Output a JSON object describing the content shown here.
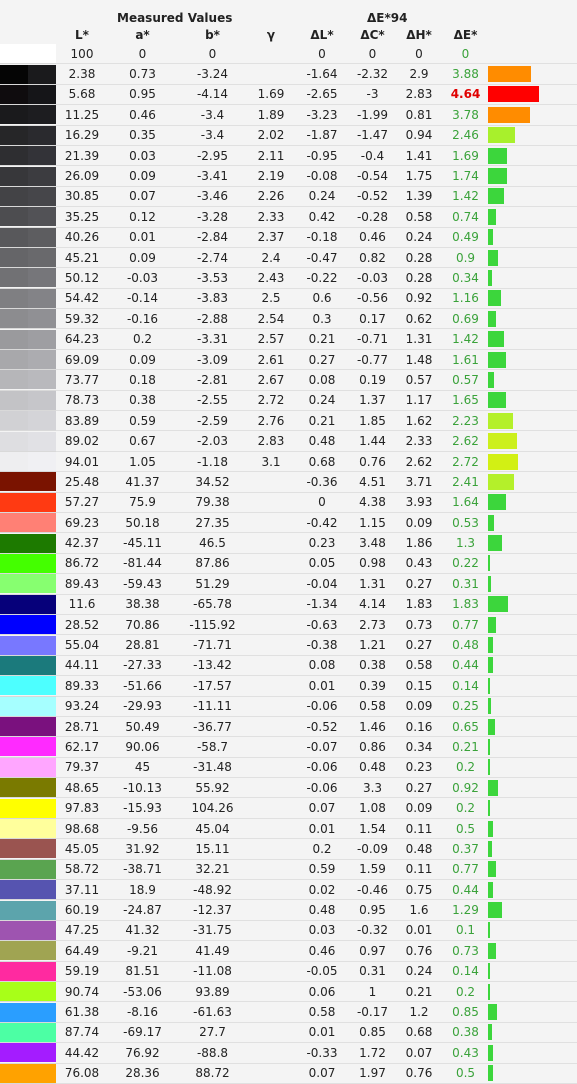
{
  "header": {
    "measured_title": "Measured Values",
    "delta_title": "ΔE*94",
    "columns": [
      "L*",
      "a*",
      "b*",
      "γ",
      "ΔL*",
      "ΔC*",
      "ΔH*",
      "ΔE*"
    ]
  },
  "rows": [
    {
      "sw": [
        "#ffffff",
        "#ffffff"
      ],
      "L": "100",
      "a": "0",
      "b": "0",
      "g": "",
      "dL": "0",
      "dC": "0",
      "dH": "0",
      "dE": "0",
      "bar": 0,
      "barColor": "#3cd63c"
    },
    {
      "sw": [
        "#050505",
        "#1a1a1c"
      ],
      "L": "2.38",
      "a": "0.73",
      "b": "-3.24",
      "g": "",
      "dL": "-1.64",
      "dC": "-2.32",
      "dH": "2.9",
      "dE": "3.88",
      "bar": 3.88,
      "barColor": "#ff8c00"
    },
    {
      "sw": [
        "#0f0c0e",
        "#151518"
      ],
      "L": "5.68",
      "a": "0.95",
      "b": "-4.14",
      "g": "1.69",
      "dL": "-2.65",
      "dC": "-3",
      "dH": "2.83",
      "dE": "4.64",
      "bar": 4.64,
      "barColor": "#ff0000",
      "warn": true
    },
    {
      "sw": [
        "#1a1a1c",
        "#1d1d20"
      ],
      "L": "11.25",
      "a": "0.46",
      "b": "-3.4",
      "g": "1.89",
      "dL": "-3.23",
      "dC": "-1.99",
      "dH": "0.81",
      "dE": "3.78",
      "bar": 3.78,
      "barColor": "#ff8c00"
    },
    {
      "sw": [
        "#262628",
        "#2a2a2e"
      ],
      "L": "16.29",
      "a": "0.35",
      "b": "-3.4",
      "g": "2.02",
      "dL": "-1.87",
      "dC": "-1.47",
      "dH": "0.94",
      "dE": "2.46",
      "bar": 2.46,
      "barColor": "#a8f02c"
    },
    {
      "sw": [
        "#2e2e31",
        "#333338"
      ],
      "L": "21.39",
      "a": "0.03",
      "b": "-2.95",
      "g": "2.11",
      "dL": "-0.95",
      "dC": "-0.4",
      "dH": "1.41",
      "dE": "1.69",
      "bar": 1.69,
      "barColor": "#3cd63c"
    },
    {
      "sw": [
        "#37373a",
        "#3c3c40"
      ],
      "L": "26.09",
      "a": "0.09",
      "b": "-3.41",
      "g": "2.19",
      "dL": "-0.08",
      "dC": "-0.54",
      "dH": "1.75",
      "dE": "1.74",
      "bar": 1.74,
      "barColor": "#3cd63c"
    },
    {
      "sw": [
        "#434346",
        "#46464a"
      ],
      "L": "30.85",
      "a": "0.07",
      "b": "-3.46",
      "g": "2.26",
      "dL": "0.24",
      "dC": "-0.52",
      "dH": "1.39",
      "dE": "1.42",
      "bar": 1.42,
      "barColor": "#3cd63c"
    },
    {
      "sw": [
        "#4d4d50",
        "#525256"
      ],
      "L": "35.25",
      "a": "0.12",
      "b": "-3.28",
      "g": "2.33",
      "dL": "0.42",
      "dC": "-0.28",
      "dH": "0.58",
      "dE": "0.74",
      "bar": 0.74,
      "barColor": "#3cd63c"
    },
    {
      "sw": [
        "#58585b",
        "#5d5d60"
      ],
      "L": "40.26",
      "a": "0.01",
      "b": "-2.84",
      "g": "2.37",
      "dL": "-0.18",
      "dC": "0.46",
      "dH": "0.24",
      "dE": "0.49",
      "bar": 0.49,
      "barColor": "#3cd63c"
    },
    {
      "sw": [
        "#656568",
        "#69696c"
      ],
      "L": "45.21",
      "a": "0.09",
      "b": "-2.74",
      "g": "2.4",
      "dL": "-0.47",
      "dC": "0.82",
      "dH": "0.28",
      "dE": "0.9",
      "bar": 0.9,
      "barColor": "#3cd63c"
    },
    {
      "sw": [
        "#717174",
        "#76767a"
      ],
      "L": "50.12",
      "a": "-0.03",
      "b": "-3.53",
      "g": "2.43",
      "dL": "-0.22",
      "dC": "-0.03",
      "dH": "0.28",
      "dE": "0.34",
      "bar": 0.34,
      "barColor": "#3cd63c"
    },
    {
      "sw": [
        "#7f7f82",
        "#838387"
      ],
      "L": "54.42",
      "a": "-0.14",
      "b": "-3.83",
      "g": "2.5",
      "dL": "0.6",
      "dC": "-0.56",
      "dH": "0.92",
      "dE": "1.16",
      "bar": 1.16,
      "barColor": "#3cd63c"
    },
    {
      "sw": [
        "#8c8c8f",
        "#909094"
      ],
      "L": "59.32",
      "a": "-0.16",
      "b": "-2.88",
      "g": "2.54",
      "dL": "0.3",
      "dC": "0.17",
      "dH": "0.62",
      "dE": "0.69",
      "bar": 0.69,
      "barColor": "#3cd63c"
    },
    {
      "sw": [
        "#9a9a9d",
        "#9e9ea2"
      ],
      "L": "64.23",
      "a": "0.2",
      "b": "-3.31",
      "g": "2.57",
      "dL": "0.21",
      "dC": "-0.71",
      "dH": "1.31",
      "dE": "1.42",
      "bar": 1.42,
      "barColor": "#3cd63c"
    },
    {
      "sw": [
        "#a8a8ab",
        "#acacb0"
      ],
      "L": "69.09",
      "a": "0.09",
      "b": "-3.09",
      "g": "2.61",
      "dL": "0.27",
      "dC": "-0.77",
      "dH": "1.48",
      "dE": "1.61",
      "bar": 1.61,
      "barColor": "#3cd63c"
    },
    {
      "sw": [
        "#b6b6b9",
        "#b9b9bd"
      ],
      "L": "73.77",
      "a": "0.18",
      "b": "-2.81",
      "g": "2.67",
      "dL": "0.08",
      "dC": "0.19",
      "dH": "0.57",
      "dE": "0.57",
      "bar": 0.57,
      "barColor": "#3cd63c"
    },
    {
      "sw": [
        "#c3c3c6",
        "#c6c6ca"
      ],
      "L": "78.73",
      "a": "0.38",
      "b": "-2.55",
      "g": "2.72",
      "dL": "0.24",
      "dC": "1.37",
      "dH": "1.17",
      "dE": "1.65",
      "bar": 1.65,
      "barColor": "#3cd63c"
    },
    {
      "sw": [
        "#d1d1d4",
        "#d4d4d8"
      ],
      "L": "83.89",
      "a": "0.59",
      "b": "-2.59",
      "g": "2.76",
      "dL": "0.21",
      "dC": "1.85",
      "dH": "1.62",
      "dE": "2.23",
      "bar": 2.23,
      "barColor": "#b4f02a"
    },
    {
      "sw": [
        "#dedee1",
        "#e1e1e5"
      ],
      "L": "89.02",
      "a": "0.67",
      "b": "-2.03",
      "g": "2.83",
      "dL": "0.48",
      "dC": "1.44",
      "dH": "2.33",
      "dE": "2.62",
      "bar": 2.62,
      "barColor": "#ccf01c"
    },
    {
      "sw": [
        "#eeeef0",
        "#f0f0f3"
      ],
      "L": "94.01",
      "a": "1.05",
      "b": "-1.18",
      "g": "3.1",
      "dL": "0.68",
      "dC": "0.76",
      "dH": "2.62",
      "dE": "2.72",
      "bar": 2.72,
      "barColor": "#d2f014"
    },
    {
      "sw": [
        "#7a1300",
        "#7a1300"
      ],
      "L": "25.48",
      "a": "41.37",
      "b": "34.52",
      "g": "",
      "dL": "-0.36",
      "dC": "4.51",
      "dH": "3.71",
      "dE": "2.41",
      "bar": 2.41,
      "barColor": "#b4f02a"
    },
    {
      "sw": [
        "#ff3a12",
        "#ff3a12"
      ],
      "L": "57.27",
      "a": "75.9",
      "b": "79.38",
      "g": "",
      "dL": "0",
      "dC": "4.38",
      "dH": "3.93",
      "dE": "1.64",
      "bar": 1.64,
      "barColor": "#3cd63c"
    },
    {
      "sw": [
        "#ff8075",
        "#ff8075"
      ],
      "L": "69.23",
      "a": "50.18",
      "b": "27.35",
      "g": "",
      "dL": "-0.42",
      "dC": "1.15",
      "dH": "0.09",
      "dE": "0.53",
      "bar": 0.53,
      "barColor": "#3cd63c"
    },
    {
      "sw": [
        "#1d7a00",
        "#1d7a00"
      ],
      "L": "42.37",
      "a": "-45.11",
      "b": "46.5",
      "g": "",
      "dL": "0.23",
      "dC": "3.48",
      "dH": "1.86",
      "dE": "1.3",
      "bar": 1.3,
      "barColor": "#3cd63c"
    },
    {
      "sw": [
        "#44ff00",
        "#44ff00"
      ],
      "L": "86.72",
      "a": "-81.44",
      "b": "87.86",
      "g": "",
      "dL": "0.05",
      "dC": "0.98",
      "dH": "0.43",
      "dE": "0.22",
      "bar": 0.22,
      "barColor": "#3cd63c"
    },
    {
      "sw": [
        "#87ff70",
        "#87ff70"
      ],
      "L": "89.43",
      "a": "-59.43",
      "b": "51.29",
      "g": "",
      "dL": "-0.04",
      "dC": "1.31",
      "dH": "0.27",
      "dE": "0.31",
      "bar": 0.31,
      "barColor": "#3cd63c"
    },
    {
      "sw": [
        "#06007a",
        "#06007a"
      ],
      "L": "11.6",
      "a": "38.38",
      "b": "-65.78",
      "g": "",
      "dL": "-1.34",
      "dC": "4.14",
      "dH": "1.83",
      "dE": "1.83",
      "bar": 1.83,
      "barColor": "#3cd63c"
    },
    {
      "sw": [
        "#0000ff",
        "#0000ff"
      ],
      "L": "28.52",
      "a": "70.86",
      "b": "-115.92",
      "g": "",
      "dL": "-0.63",
      "dC": "2.73",
      "dH": "0.73",
      "dE": "0.77",
      "bar": 0.77,
      "barColor": "#3cd63c"
    },
    {
      "sw": [
        "#7878ff",
        "#7878ff"
      ],
      "L": "55.04",
      "a": "28.81",
      "b": "-71.71",
      "g": "",
      "dL": "-0.38",
      "dC": "1.21",
      "dH": "0.27",
      "dE": "0.48",
      "bar": 0.48,
      "barColor": "#3cd63c"
    },
    {
      "sw": [
        "#1b7a7c",
        "#1b7a7c"
      ],
      "L": "44.11",
      "a": "-27.33",
      "b": "-13.42",
      "g": "",
      "dL": "0.08",
      "dC": "0.38",
      "dH": "0.58",
      "dE": "0.44",
      "bar": 0.44,
      "barColor": "#3cd63c"
    },
    {
      "sw": [
        "#4dffff",
        "#4dffff"
      ],
      "L": "89.33",
      "a": "-51.66",
      "b": "-17.57",
      "g": "",
      "dL": "0.01",
      "dC": "0.39",
      "dH": "0.15",
      "dE": "0.14",
      "bar": 0.14,
      "barColor": "#3cd63c"
    },
    {
      "sw": [
        "#a6ffff",
        "#a6ffff"
      ],
      "L": "93.24",
      "a": "-29.93",
      "b": "-11.11",
      "g": "",
      "dL": "-0.06",
      "dC": "0.58",
      "dH": "0.09",
      "dE": "0.25",
      "bar": 0.25,
      "barColor": "#3cd63c"
    },
    {
      "sw": [
        "#7a117e",
        "#7a117e"
      ],
      "L": "28.71",
      "a": "50.49",
      "b": "-36.77",
      "g": "",
      "dL": "-0.52",
      "dC": "1.46",
      "dH": "0.16",
      "dE": "0.65",
      "bar": 0.65,
      "barColor": "#3cd63c"
    },
    {
      "sw": [
        "#ff2aff",
        "#ff2aff"
      ],
      "L": "62.17",
      "a": "90.06",
      "b": "-58.7",
      "g": "",
      "dL": "-0.07",
      "dC": "0.86",
      "dH": "0.34",
      "dE": "0.21",
      "bar": 0.21,
      "barColor": "#3cd63c"
    },
    {
      "sw": [
        "#ffa6ff",
        "#ffa6ff"
      ],
      "L": "79.37",
      "a": "45",
      "b": "-31.48",
      "g": "",
      "dL": "-0.06",
      "dC": "0.48",
      "dH": "0.23",
      "dE": "0.2",
      "bar": 0.2,
      "barColor": "#3cd63c"
    },
    {
      "sw": [
        "#7a7a00",
        "#7a7a00"
      ],
      "L": "48.65",
      "a": "-10.13",
      "b": "55.92",
      "g": "",
      "dL": "-0.06",
      "dC": "3.3",
      "dH": "0.27",
      "dE": "0.92",
      "bar": 0.92,
      "barColor": "#3cd63c"
    },
    {
      "sw": [
        "#ffff00",
        "#ffff00"
      ],
      "L": "97.83",
      "a": "-15.93",
      "b": "104.26",
      "g": "",
      "dL": "0.07",
      "dC": "1.08",
      "dH": "0.09",
      "dE": "0.2",
      "bar": 0.2,
      "barColor": "#3cd63c"
    },
    {
      "sw": [
        "#ffff9c",
        "#ffff9c"
      ],
      "L": "98.68",
      "a": "-9.56",
      "b": "45.04",
      "g": "",
      "dL": "0.01",
      "dC": "1.54",
      "dH": "0.11",
      "dE": "0.5",
      "bar": 0.5,
      "barColor": "#3cd63c"
    },
    {
      "sw": [
        "#9a5450",
        "#9a5450"
      ],
      "L": "45.05",
      "a": "31.92",
      "b": "15.11",
      "g": "",
      "dL": "0.2",
      "dC": "-0.09",
      "dH": "0.48",
      "dE": "0.37",
      "bar": 0.37,
      "barColor": "#3cd63c"
    },
    {
      "sw": [
        "#5aa450",
        "#5aa450"
      ],
      "L": "58.72",
      "a": "-38.71",
      "b": "32.21",
      "g": "",
      "dL": "0.59",
      "dC": "1.59",
      "dH": "0.11",
      "dE": "0.77",
      "bar": 0.77,
      "barColor": "#3cd63c"
    },
    {
      "sw": [
        "#5654b0",
        "#5654b0"
      ],
      "L": "37.11",
      "a": "18.9",
      "b": "-48.92",
      "g": "",
      "dL": "0.02",
      "dC": "-0.46",
      "dH": "0.75",
      "dE": "0.44",
      "bar": 0.44,
      "barColor": "#3cd63c"
    },
    {
      "sw": [
        "#5ca4ac",
        "#5ca4ac"
      ],
      "L": "60.19",
      "a": "-24.87",
      "b": "-12.37",
      "g": "",
      "dL": "0.48",
      "dC": "0.95",
      "dH": "1.6",
      "dE": "1.29",
      "bar": 1.29,
      "barColor": "#3cd63c"
    },
    {
      "sw": [
        "#9e54b0",
        "#9e54b0"
      ],
      "L": "47.25",
      "a": "41.32",
      "b": "-31.75",
      "g": "",
      "dL": "0.03",
      "dC": "-0.32",
      "dH": "0.01",
      "dE": "0.1",
      "bar": 0.1,
      "barColor": "#3cd63c"
    },
    {
      "sw": [
        "#a0a452",
        "#a0a452"
      ],
      "L": "64.49",
      "a": "-9.21",
      "b": "41.49",
      "g": "",
      "dL": "0.46",
      "dC": "0.97",
      "dH": "0.76",
      "dE": "0.73",
      "bar": 0.73,
      "barColor": "#3cd63c"
    },
    {
      "sw": [
        "#ff2aa0",
        "#ff2aa0"
      ],
      "L": "59.19",
      "a": "81.51",
      "b": "-11.08",
      "g": "",
      "dL": "-0.05",
      "dC": "0.31",
      "dH": "0.24",
      "dE": "0.14",
      "bar": 0.14,
      "barColor": "#3cd63c"
    },
    {
      "sw": [
        "#a8ff18",
        "#a8ff18"
      ],
      "L": "90.74",
      "a": "-53.06",
      "b": "93.89",
      "g": "",
      "dL": "0.06",
      "dC": "1",
      "dH": "0.21",
      "dE": "0.2",
      "bar": 0.2,
      "barColor": "#3cd63c"
    },
    {
      "sw": [
        "#2a9eff",
        "#2a9eff"
      ],
      "L": "61.38",
      "a": "-8.16",
      "b": "-61.63",
      "g": "",
      "dL": "0.58",
      "dC": "-0.17",
      "dH": "1.2",
      "dE": "0.85",
      "bar": 0.85,
      "barColor": "#3cd63c"
    },
    {
      "sw": [
        "#4cffa4",
        "#4cffa4"
      ],
      "L": "87.74",
      "a": "-69.17",
      "b": "27.7",
      "g": "",
      "dL": "0.01",
      "dC": "0.85",
      "dH": "0.68",
      "dE": "0.38",
      "bar": 0.38,
      "barColor": "#3cd63c"
    },
    {
      "sw": [
        "#a41cff",
        "#a41cff"
      ],
      "L": "44.42",
      "a": "76.92",
      "b": "-88.8",
      "g": "",
      "dL": "-0.33",
      "dC": "1.72",
      "dH": "0.07",
      "dE": "0.43",
      "bar": 0.43,
      "barColor": "#3cd63c"
    },
    {
      "sw": [
        "#ffa200",
        "#ffa200"
      ],
      "L": "76.08",
      "a": "28.36",
      "b": "88.72",
      "g": "",
      "dL": "0.07",
      "dC": "1.97",
      "dH": "0.76",
      "dE": "0.5",
      "bar": 0.5,
      "barColor": "#3cd63c"
    }
  ]
}
